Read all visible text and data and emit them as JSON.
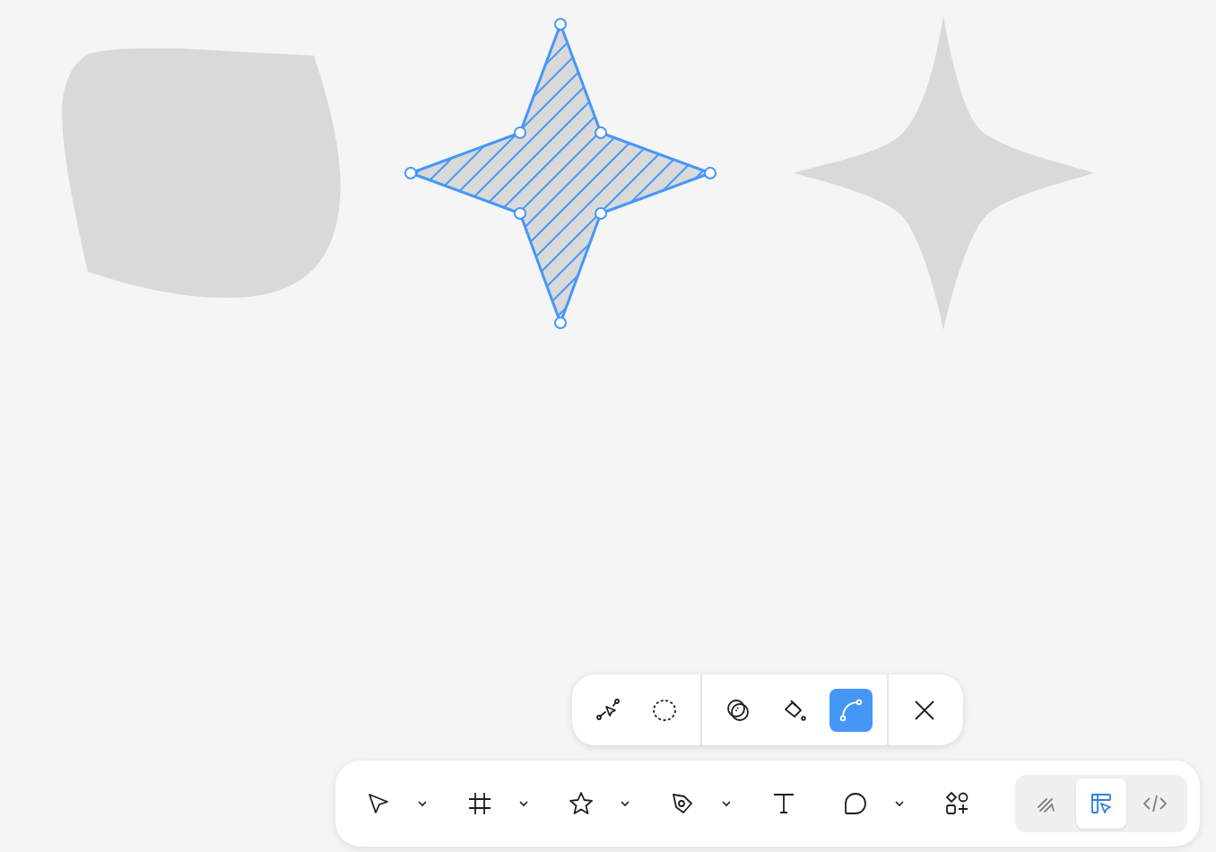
{
  "canvas": {
    "shapes": [
      {
        "kind": "blob",
        "selected": false
      },
      {
        "kind": "star",
        "selected": true
      },
      {
        "kind": "sparkle",
        "selected": false
      }
    ]
  },
  "edit_toolbar": {
    "groups": [
      [
        {
          "kind": "bend",
          "selected": false
        },
        {
          "kind": "lasso",
          "selected": false
        }
      ],
      [
        {
          "kind": "boolean",
          "selected": false
        },
        {
          "kind": "paint",
          "selected": false
        },
        {
          "kind": "curve",
          "selected": true
        }
      ],
      [
        {
          "kind": "close",
          "selected": false
        }
      ]
    ]
  },
  "toolbar": {
    "tools": [
      {
        "kind": "move",
        "dropdown": true
      },
      {
        "kind": "frame",
        "dropdown": true
      },
      {
        "kind": "star",
        "dropdown": true
      },
      {
        "kind": "pen",
        "dropdown": true
      },
      {
        "kind": "text",
        "dropdown": false
      },
      {
        "kind": "comment",
        "dropdown": true
      },
      {
        "kind": "assets",
        "dropdown": false
      }
    ],
    "modes": [
      {
        "kind": "draw",
        "selected": false
      },
      {
        "kind": "design",
        "selected": true
      },
      {
        "kind": "dev",
        "selected": false
      }
    ]
  }
}
